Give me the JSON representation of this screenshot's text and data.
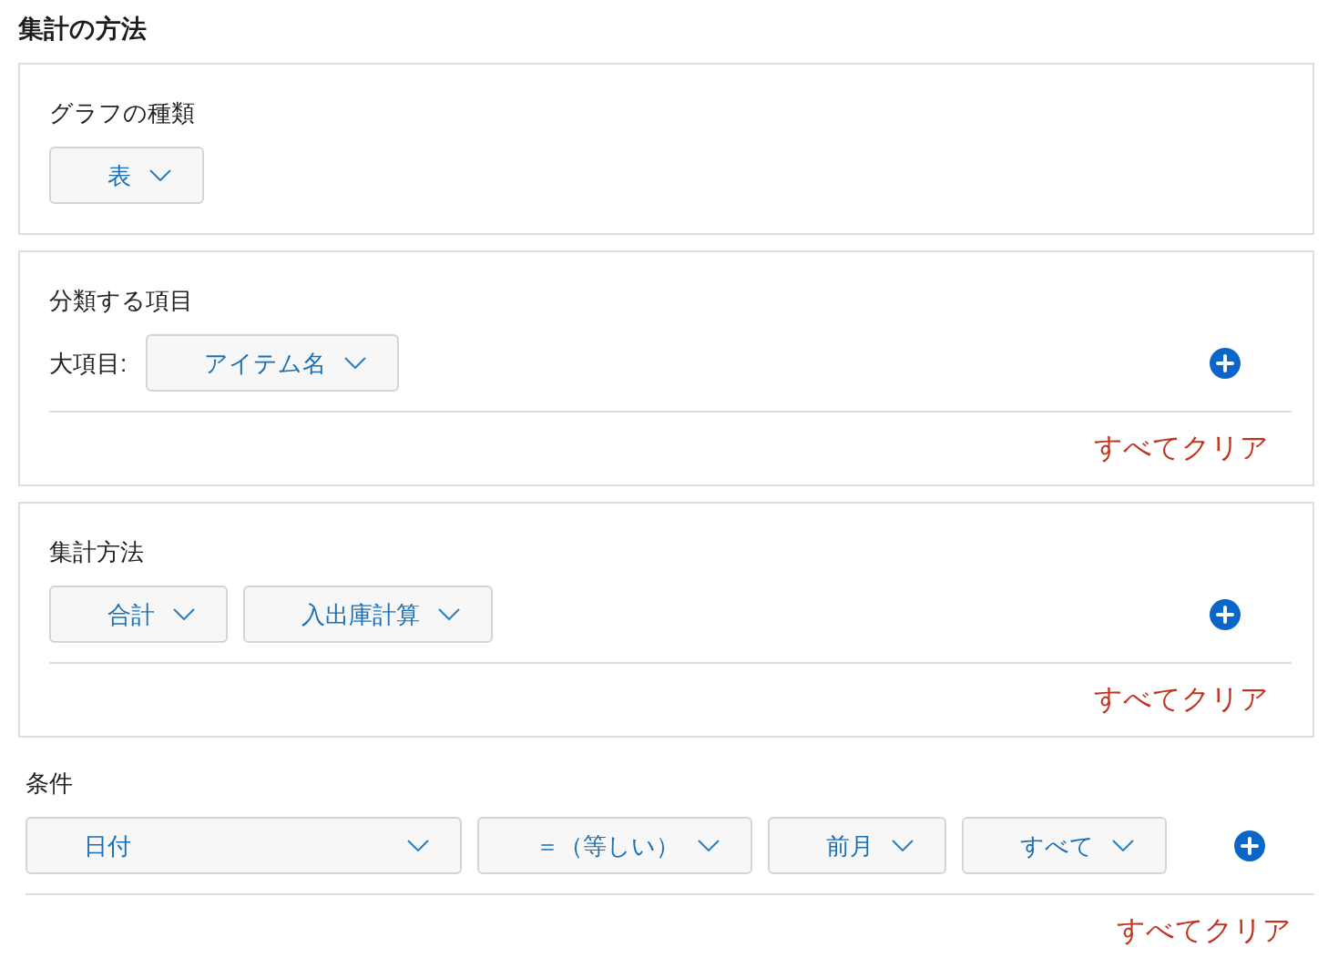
{
  "title": "集計の方法",
  "sections": [
    {
      "framed": true,
      "label": "グラフの種類",
      "dropdowns": [
        "表"
      ]
    },
    {
      "framed": true,
      "label": "分類する項目",
      "field_label": "大項目:",
      "dropdowns": [
        "アイテム名"
      ],
      "clear_link": "すべてクリア"
    },
    {
      "framed": true,
      "label": "集計方法",
      "dropdowns": [
        "合計",
        "入出庫計算"
      ],
      "clear_link": "すべてクリア"
    },
    {
      "framed": false,
      "label": "条件",
      "dropdowns": [
        "日付",
        "＝（等しい）",
        "前月",
        "すべて"
      ],
      "clear_link": "すべてクリア"
    }
  ]
}
